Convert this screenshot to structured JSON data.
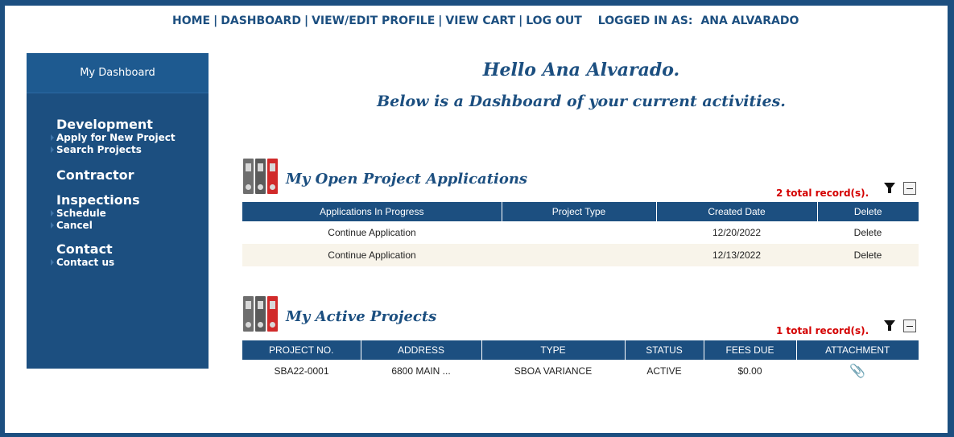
{
  "nav": {
    "home": "HOME",
    "dashboard": "DASHBOARD",
    "profile": "VIEW/EDIT PROFILE",
    "cart": "VIEW CART",
    "logout": "LOG OUT",
    "logged_in_label": "LOGGED IN AS:",
    "username": "ANA ALVARADO",
    "separator": "|"
  },
  "sidebar": {
    "header": "My Dashboard",
    "groups": [
      {
        "title": "Development",
        "links": [
          "Apply for New Project",
          "Search Projects"
        ]
      },
      {
        "title": "Contractor",
        "links": []
      },
      {
        "title": "Inspections",
        "links": [
          "Schedule",
          "Cancel"
        ]
      },
      {
        "title": "Contact",
        "links": [
          "Contact us"
        ]
      }
    ]
  },
  "main": {
    "greeting": "Hello Ana Alvarado.",
    "subtitle": "Below is a Dashboard of your current activities."
  },
  "open_apps": {
    "title": "My Open Project Applications",
    "records": "2 total record(s).",
    "columns": [
      "Applications In Progress",
      "Project Type",
      "Created Date",
      "Delete"
    ],
    "rows": [
      {
        "action": "Continue Application",
        "type": "",
        "date": "12/20/2022",
        "delete": "Delete"
      },
      {
        "action": "Continue Application",
        "type": "",
        "date": "12/13/2022",
        "delete": "Delete"
      }
    ]
  },
  "active": {
    "title": "My Active Projects",
    "records": "1 total record(s).",
    "columns": [
      "PROJECT NO.",
      "ADDRESS",
      "TYPE",
      "STATUS",
      "FEES DUE",
      "ATTACHMENT"
    ],
    "rows": [
      {
        "project_no": "SBA22-0001",
        "address": "6800 MAIN ...",
        "type": "SBOA VARIANCE",
        "status": "ACTIVE",
        "fees": "$0.00",
        "attachment_icon": "paperclip-icon"
      }
    ]
  },
  "colors": {
    "brand": "#1c4f80",
    "alert": "#d40000",
    "row_alt": "#f8f4ea"
  }
}
